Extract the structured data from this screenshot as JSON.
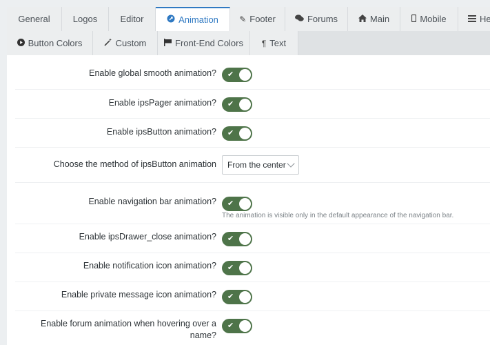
{
  "tabs_row1": [
    {
      "label": "General",
      "icon": "",
      "active": false
    },
    {
      "label": "Logos",
      "icon": "",
      "active": false
    },
    {
      "label": "Editor",
      "icon": "",
      "active": false
    },
    {
      "label": "Animation",
      "icon": "rocket-icon",
      "active": true
    },
    {
      "label": "Footer",
      "icon": "pencil-icon",
      "active": false
    },
    {
      "label": "Forums",
      "icon": "comments-icon",
      "active": false
    },
    {
      "label": "Main",
      "icon": "home-icon",
      "active": false
    },
    {
      "label": "Mobile",
      "icon": "mobile-icon",
      "active": false
    },
    {
      "label": "Hea",
      "icon": "bars-icon",
      "active": false
    }
  ],
  "tabs_row2": [
    {
      "label": "Button Colors",
      "icon": "circle-play-icon"
    },
    {
      "label": "Custom",
      "icon": "magic-wand-icon"
    },
    {
      "label": "Front-End Colors",
      "icon": "flag-icon"
    },
    {
      "label": "Text",
      "icon": "paragraph-icon"
    }
  ],
  "settings": [
    {
      "label": "Enable global smooth animation?",
      "type": "toggle",
      "value": true
    },
    {
      "label": "Enable ipsPager animation?",
      "type": "toggle",
      "value": true
    },
    {
      "label": "Enable ipsButton animation?",
      "type": "toggle",
      "value": true
    },
    {
      "label": "Choose the method of ipsButton animation",
      "type": "select",
      "value": "From the center"
    },
    {
      "label": "Enable navigation bar animation?",
      "type": "toggle",
      "value": true,
      "description": "The animation is visible only in the default appearance of the navigation bar."
    },
    {
      "label": "Enable ipsDrawer_close animation?",
      "type": "toggle",
      "value": true
    },
    {
      "label": "Enable notification icon animation?",
      "type": "toggle",
      "value": true
    },
    {
      "label": "Enable private message icon animation?",
      "type": "toggle",
      "value": true
    },
    {
      "label": "Enable forum animation when hovering over a name?",
      "type": "toggle",
      "value": true
    }
  ],
  "colors": {
    "accent": "#2f79c2",
    "toggle_on": "#4e7449"
  }
}
